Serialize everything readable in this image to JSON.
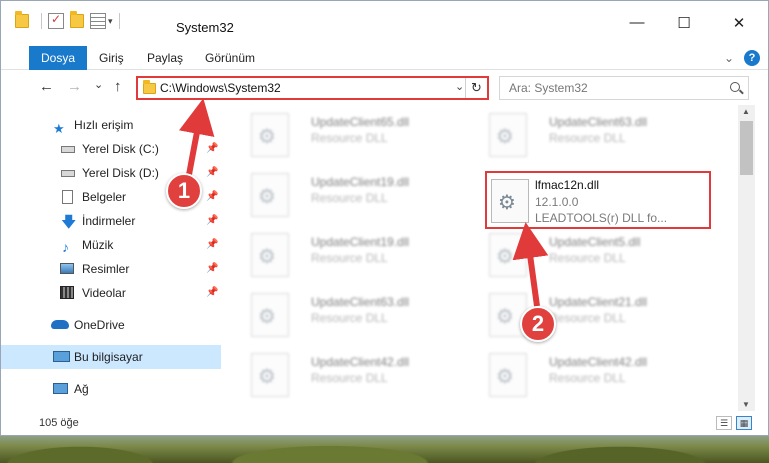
{
  "window": {
    "title": "System32",
    "controls": {
      "minimize": "—",
      "maximize": "☐",
      "close": "✕"
    }
  },
  "ribbon": {
    "tabs": [
      {
        "label": "Dosya",
        "active": true
      },
      {
        "label": "Giriş"
      },
      {
        "label": "Paylaş"
      },
      {
        "label": "Görünüm"
      }
    ],
    "expand_icon": "chevron-down-icon",
    "help": "?"
  },
  "nav": {
    "back": "←",
    "forward": "→",
    "recent": "⌄",
    "up": "↑",
    "address": "C:\\Windows\\System32",
    "dropdown": "⌄",
    "refresh": "↻",
    "search_placeholder": "Ara: System32"
  },
  "sidebar": {
    "items": [
      {
        "label": "Hızlı erişim",
        "icon": "star-icon"
      },
      {
        "label": "Yerel Disk (C:)",
        "icon": "drive-icon",
        "pinned": true
      },
      {
        "label": "Yerel Disk (D:)",
        "icon": "drive-icon",
        "pinned": true
      },
      {
        "label": "Belgeler",
        "icon": "document-icon",
        "pinned": true
      },
      {
        "label": "İndirmeler",
        "icon": "download-icon",
        "pinned": true
      },
      {
        "label": "Müzik",
        "icon": "music-icon",
        "pinned": true
      },
      {
        "label": "Resimler",
        "icon": "pictures-icon",
        "pinned": true
      },
      {
        "label": "Videolar",
        "icon": "video-icon",
        "pinned": true
      },
      {
        "label": "OneDrive",
        "icon": "cloud-icon"
      },
      {
        "label": "Bu bilgisayar",
        "icon": "computer-icon",
        "selected": true
      },
      {
        "label": "Ağ",
        "icon": "network-icon"
      }
    ],
    "pin_glyph": "📌"
  },
  "files": [
    {
      "name": "UpdateClient65.dll",
      "type": "Resource DLL"
    },
    {
      "name": "UpdateClient63.dll",
      "type": "Resource DLL"
    },
    {
      "name": "UpdateClient19.dll",
      "type": "Resource DLL"
    },
    {
      "name": "lfmac12n.dll",
      "version": "12.1.0.0",
      "description": "LEADTOOLS(r) DLL fo..."
    },
    {
      "name": "UpdateClient19.dll",
      "type": "Resource DLL"
    },
    {
      "name": "UpdateClient5.dll",
      "type": "Resource DLL"
    },
    {
      "name": "UpdateClient63.dll",
      "type": "Resource DLL"
    },
    {
      "name": "UpdateClient21.dll",
      "type": "Resource DLL"
    },
    {
      "name": "UpdateClient42.dll",
      "type": "Resource DLL"
    },
    {
      "name": "UpdateClient42.dll",
      "type": "Resource DLL"
    }
  ],
  "status": {
    "count": "105 öğe"
  },
  "annotations": {
    "badge1": "1",
    "badge2": "2",
    "color": "#e03a3a"
  }
}
